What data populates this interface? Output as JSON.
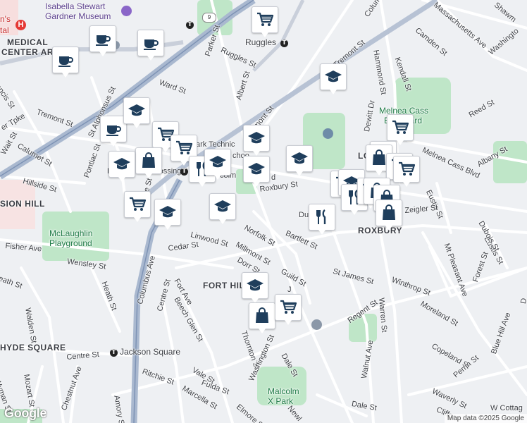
{
  "map": {
    "attribution": "Map data ©2025 Google",
    "logo_text": "Google",
    "colors": {
      "base": "#eef0f3",
      "park": "#bfe6c8",
      "road": "#ffffff",
      "highway": "#a9b8cf",
      "marker_icon": "#1f3e5c"
    }
  },
  "labels": {
    "isabella": "Isabella Stewart",
    "gardner": "Gardner Museum",
    "medical": "MEDICAL",
    "center_ar": "CENTER AR",
    "mission_hill": "SION HILL",
    "fort_hill": "FORT HILL",
    "hyde_square": "HYDE SQUARE",
    "roxbury": "ROXBURY",
    "mclaughlin_1": "McLaughlin",
    "mclaughlin_2": "Playground",
    "melnea_1": "Melnea Cass",
    "melnea_2": "Boulevard",
    "malcolm_1": "Malcolm",
    "malcolm_2": "X Park",
    "jackson_square": "Jackson Square",
    "ruggles_station": "Ruggles",
    "roxbury_crossing": "Crossing",
    "northeastern": "ark Technic",
    "school": "choo",
    "hospital_fragment": "n's",
    "hospital_fragment2": "tal",
    "lo": "LO",
    "r": "R",
    "lincoln": "colm",
    "lincoln_d": "d",
    "j": "J",
    "p": "P",
    "ace_st": "ace St",
    "streets": {
      "columbus_ave_n": "Colum",
      "massachusetts_ave": "Massachusetts Ave",
      "shawmut": "Shawm",
      "washington_n": "Washingto",
      "camden": "Camden St",
      "tremont_e": "Tremont St",
      "hammond": "Hammond St",
      "kendall": "Kendall St",
      "ruggles_st": "Ruggles St",
      "parker": "Parker St",
      "ward": "Ward St",
      "albert": "Albert St",
      "tremont_c": "Tremont St",
      "tremont_w": "Tremont St",
      "francis": "ancis St",
      "pike": "er Tpke",
      "st_alphonsus": "St Alphonsus St",
      "wait": "Wait St",
      "calumet": "Calumet St",
      "hillside": "Hillside St",
      "pontiac": "Pontiac St",
      "fisher": "Fisher Ave",
      "wensley": "Wensley St",
      "heath_w": "eath St",
      "heath": "Heath St",
      "walden": "Walden St",
      "columbus_ave_s": "Columbus Ave",
      "cedar": "Cedar St",
      "linwood": "Linwood St",
      "norfolk": "Norfolk St",
      "millmont": "Millmont St",
      "dorr": "Dorr St",
      "bartlett": "Bartlett St",
      "guild": "Guild St",
      "roxbury_st": "Roxbury St",
      "dudley": "Dud",
      "st_james": "St James St",
      "winthrop": "Winthrop St",
      "regent": "Regent St",
      "fort_ave": "Fort Ave",
      "centre_s": "Centre St",
      "beech_glen": "Beech Glen St",
      "thornton": "Thornton St",
      "washington_s": "Washington St",
      "dale": "Dale St",
      "dale_s": "Dale St",
      "walnut": "Walnut Ave",
      "warren": "Warren St",
      "moreland": "Moreland St",
      "mt_pleasant": "Mt Pleasant Ave",
      "blue_hill": "Blue Hill Ave",
      "cope": "Copeland St",
      "perrin": "Perrin St",
      "waverly": "Waverly St",
      "clifford": "Cliffor",
      "w_cottage": "W Cottag",
      "forest": "Forest St",
      "dewitt": "Dewitt Dr",
      "reed": "Reed St",
      "melnea_blvd": "Melnea Cass Blvd",
      "albany": "Albany St",
      "eustis_n": "Eustis St",
      "eustis_s": "Eustis St",
      "dubois": "Dubois St",
      "zeigler": "Zeigler St",
      "centre_w": "Centre St",
      "ritchie": "Ritchie St",
      "fulda": "Fulda St",
      "vale": "Vale St",
      "marcella": "Marcella St",
      "amory": "Amory St",
      "chestnut": "Chestnut Ave",
      "wyman": "Wyman St",
      "mozart": "Mozart St",
      "elmore": "Elmore St",
      "newl": "Newl",
      "d_st": "D"
    }
  },
  "markers": [
    {
      "type": "coffee-icon"
    },
    {
      "type": "coffee-icon"
    },
    {
      "type": "coffee-icon"
    },
    {
      "type": "coffee-icon"
    },
    {
      "type": "grocery-cart-icon"
    },
    {
      "type": "school-icon"
    },
    {
      "type": "school-icon"
    },
    {
      "type": "grocery-cart-icon"
    },
    {
      "type": "grocery-cart-icon"
    },
    {
      "type": "school-icon"
    },
    {
      "type": "shopping-bag-icon"
    },
    {
      "type": "grocery-cart-icon"
    },
    {
      "type": "restaurant-icon"
    },
    {
      "type": "school-icon"
    },
    {
      "type": "school-icon"
    },
    {
      "type": "school-icon"
    },
    {
      "type": "school-icon"
    },
    {
      "type": "grocery-cart-icon"
    },
    {
      "type": "school-icon"
    },
    {
      "type": "school-icon"
    },
    {
      "type": "restaurant-icon"
    },
    {
      "type": "grocery-cart-icon"
    },
    {
      "type": "school-icon"
    },
    {
      "type": "grocery-cart-icon"
    },
    {
      "type": "shopping-bag-icon"
    },
    {
      "type": "grocery-cart-icon"
    },
    {
      "type": "grocery-cart-icon"
    },
    {
      "type": "restaurant-icon"
    },
    {
      "type": "grocery-cart-icon"
    },
    {
      "type": "shopping-bag-icon"
    },
    {
      "type": "shopping-bag-icon"
    },
    {
      "type": "shopping-bag-icon"
    },
    {
      "type": "school-icon"
    },
    {
      "type": "shopping-bag-icon"
    },
    {
      "type": "grocery-cart-icon"
    }
  ]
}
